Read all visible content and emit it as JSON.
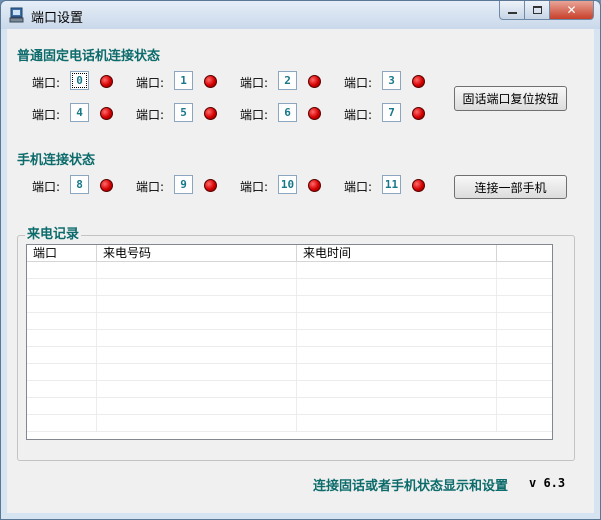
{
  "window": {
    "title": "端口设置",
    "close_glyph": "✕"
  },
  "landline": {
    "section_title": "普通固定电话机连接状态",
    "port_label": "端口:",
    "ports": [
      "0",
      "1",
      "2",
      "3",
      "4",
      "5",
      "6",
      "7"
    ],
    "reset_button": "固话端口复位按钮"
  },
  "mobile": {
    "section_title": "手机连接状态",
    "port_label": "端口:",
    "ports": [
      "8",
      "9",
      "10",
      "11"
    ],
    "connect_button": "连接一部手机"
  },
  "call_log": {
    "group_title": "来电记录",
    "columns": [
      "端口",
      "来电号码",
      "来电时间",
      ""
    ]
  },
  "footer": {
    "text": "连接固话或者手机状态显示和设置",
    "version": "v 6.3"
  },
  "colors": {
    "accent_teal": "#0d6b6b",
    "led_red": "#d40000"
  },
  "icons": {
    "app": "phone-app-icon",
    "status": "red-led-indicator"
  }
}
